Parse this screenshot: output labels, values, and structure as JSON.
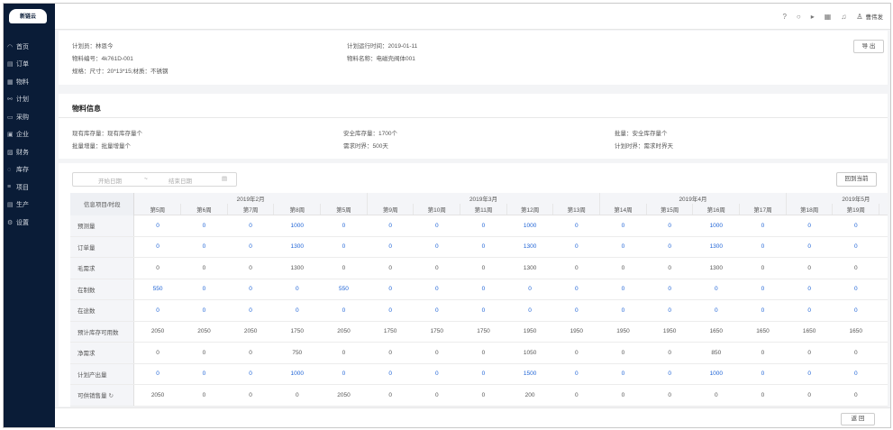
{
  "app": {
    "logo_text": "新链云"
  },
  "nav": [
    {
      "icon": "dashboard-icon",
      "glyph": "◠",
      "label": "首页"
    },
    {
      "icon": "order-icon",
      "glyph": "▤",
      "label": "订单"
    },
    {
      "icon": "material-icon",
      "glyph": "▦",
      "label": "物料"
    },
    {
      "icon": "plan-icon",
      "glyph": "⚯",
      "label": "计划"
    },
    {
      "icon": "purchase-icon",
      "glyph": "▭",
      "label": "采购"
    },
    {
      "icon": "enterprise-icon",
      "glyph": "▣",
      "label": "企业"
    },
    {
      "icon": "finance-icon",
      "glyph": "▨",
      "label": "财务"
    },
    {
      "icon": "warehouse-icon",
      "glyph": "◌",
      "label": "库存"
    },
    {
      "icon": "project-icon",
      "glyph": "≡",
      "label": "项目"
    },
    {
      "icon": "production-icon",
      "glyph": "▤",
      "label": "生产"
    },
    {
      "icon": "settings-icon",
      "glyph": "⚙",
      "label": "设置"
    }
  ],
  "topbar": {
    "icons": [
      {
        "name": "help-icon",
        "glyph": "?"
      },
      {
        "name": "search-icon",
        "glyph": "○"
      },
      {
        "name": "play-icon",
        "glyph": "▸"
      },
      {
        "name": "qrcode-icon",
        "glyph": "▦"
      },
      {
        "name": "notification-icon",
        "glyph": "♫"
      }
    ],
    "user_icon": "user-icon",
    "user_name": "曹伟发"
  },
  "header": {
    "planner": "计划员：林恩今",
    "material_no": "物料编号：4k761D-001",
    "spec": "规格：尺寸：20*13*15;材质：不锈钢",
    "run_time": "计划运行时间：2019-01-11",
    "material_name": "物料名称：电磁壳阀体001",
    "export_label": "导 出"
  },
  "material_info": {
    "title": "物料信息",
    "stock": "现有库存量：现有库存量个",
    "increment": "批量增量：批量增量个",
    "safety_stock": "安全库存量：1700个",
    "demand_boundary": "需求时界：500天",
    "batch": "批量：安全库存量个",
    "plan_boundary": "计划时界：需求时界天"
  },
  "plan": {
    "start_placeholder": "开始日期",
    "range_sep": "~",
    "end_placeholder": "结束日期",
    "today_label": "回到当前",
    "corner": "信息项目/时段",
    "months": [
      {
        "label": "2019年2月",
        "span": 5
      },
      {
        "label": "2019年3月",
        "span": 5
      },
      {
        "label": "2019年4月",
        "span": 4
      },
      {
        "label": "2019年5月",
        "span": 3
      }
    ],
    "weeks": [
      "第5周",
      "第6周",
      "第7周",
      "第8周",
      "第5周",
      "第9周",
      "第10周",
      "第11周",
      "第12周",
      "第13周",
      "第14周",
      "第15周",
      "第16周",
      "第17周",
      "第18周",
      "第19周",
      "第20周"
    ],
    "rows": [
      {
        "label": "预测量",
        "blue": true,
        "values": [
          "0",
          "0",
          "0",
          "1000",
          "0",
          "0",
          "0",
          "0",
          "1000",
          "0",
          "0",
          "0",
          "1000",
          "0",
          "0",
          "0",
          "1000"
        ]
      },
      {
        "label": "订单量",
        "blue": true,
        "values": [
          "0",
          "0",
          "0",
          "1300",
          "0",
          "0",
          "0",
          "0",
          "1300",
          "0",
          "0",
          "0",
          "1300",
          "0",
          "0",
          "0",
          "1300"
        ]
      },
      {
        "label": "毛需求",
        "blue": false,
        "values": [
          "0",
          "0",
          "0",
          "1300",
          "0",
          "0",
          "0",
          "0",
          "1300",
          "0",
          "0",
          "0",
          "1300",
          "0",
          "0",
          "0",
          "1300"
        ]
      },
      {
        "label": "在制数",
        "blue": true,
        "values": [
          "550",
          "0",
          "0",
          "0",
          "550",
          "0",
          "0",
          "0",
          "0",
          "0",
          "0",
          "0",
          "0",
          "0",
          "0",
          "0",
          "0"
        ]
      },
      {
        "label": "在途数",
        "blue": true,
        "values": [
          "0",
          "0",
          "0",
          "0",
          "0",
          "0",
          "0",
          "0",
          "0",
          "0",
          "0",
          "0",
          "0",
          "0",
          "0",
          "0",
          "0"
        ]
      },
      {
        "label": "预计库存可用数",
        "blue": false,
        "values": [
          "2050",
          "2050",
          "2050",
          "1750",
          "2050",
          "1750",
          "1750",
          "1750",
          "1950",
          "1950",
          "1950",
          "1950",
          "1650",
          "1650",
          "1650",
          "1650",
          "1850"
        ]
      },
      {
        "label": "净需求",
        "blue": false,
        "values": [
          "0",
          "0",
          "0",
          "750",
          "0",
          "0",
          "0",
          "0",
          "1050",
          "0",
          "0",
          "0",
          "850",
          "0",
          "0",
          "0",
          "1150"
        ]
      },
      {
        "label": "计划产出量",
        "blue": true,
        "values": [
          "0",
          "0",
          "0",
          "1000",
          "0",
          "0",
          "0",
          "0",
          "1500",
          "0",
          "0",
          "0",
          "1000",
          "0",
          "0",
          "0",
          "1500"
        ]
      },
      {
        "label": "可供销售量",
        "blue": false,
        "values": [
          "2050",
          "0",
          "0",
          "0",
          "2050",
          "0",
          "0",
          "0",
          "200",
          "0",
          "0",
          "0",
          "0",
          "0",
          "0",
          "0",
          "200"
        ]
      }
    ],
    "refresh_icon": "refresh-icon"
  },
  "footer": {
    "back_label": "返 回"
  }
}
